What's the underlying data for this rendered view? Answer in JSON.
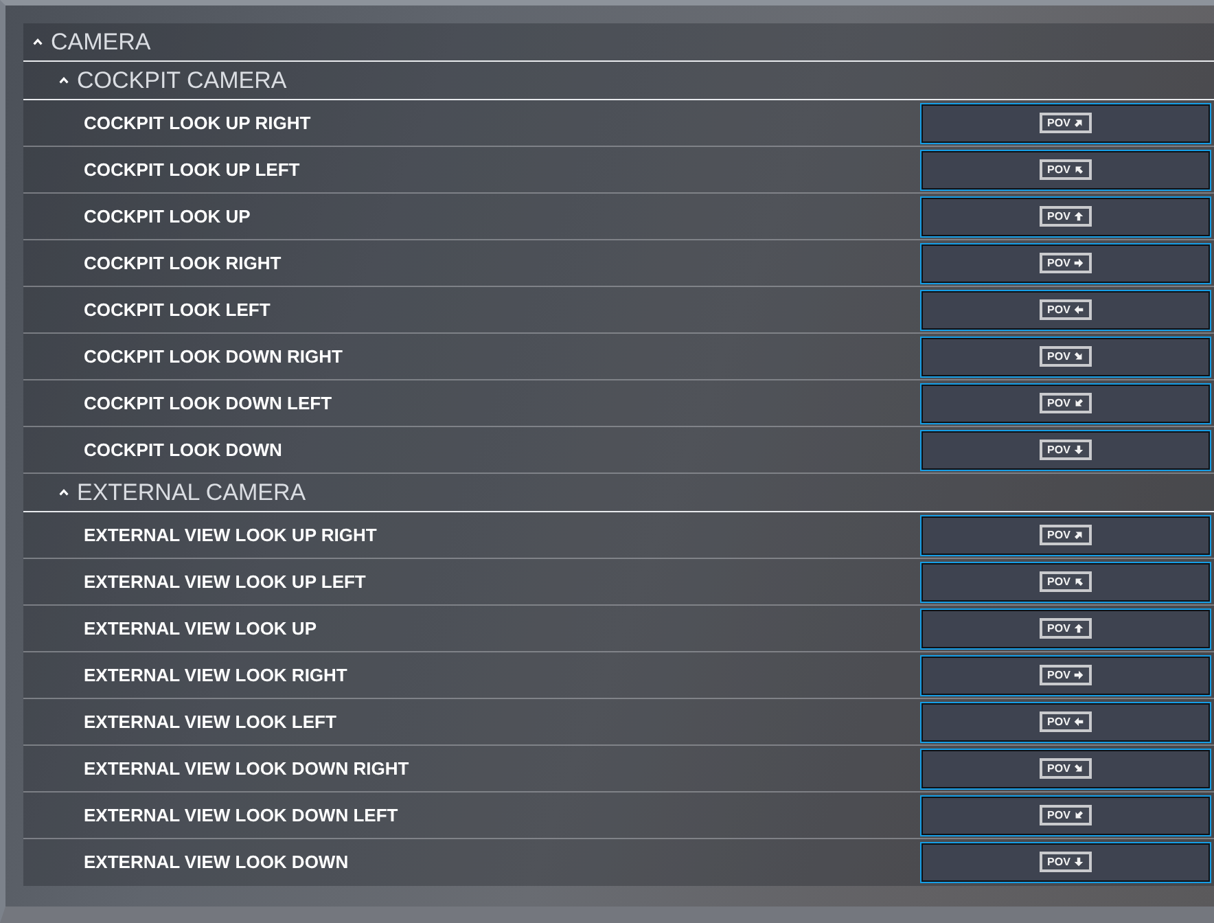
{
  "sections": [
    {
      "title": "CAMERA",
      "expanded": true,
      "groups": [
        {
          "title": "COCKPIT CAMERA",
          "expanded": true,
          "bindings": [
            {
              "action": "COCKPIT LOOK UP RIGHT",
              "key": {
                "label": "POV",
                "kind": "up-right"
              }
            },
            {
              "action": "COCKPIT LOOK UP LEFT",
              "key": {
                "label": "POV",
                "kind": "up-left"
              }
            },
            {
              "action": "COCKPIT LOOK UP",
              "key": {
                "label": "POV",
                "kind": "up"
              }
            },
            {
              "action": "COCKPIT LOOK RIGHT",
              "key": {
                "label": "POV",
                "kind": "right"
              }
            },
            {
              "action": "COCKPIT LOOK LEFT",
              "key": {
                "label": "POV",
                "kind": "left"
              }
            },
            {
              "action": "COCKPIT LOOK DOWN RIGHT",
              "key": {
                "label": "POV",
                "kind": "down-right"
              }
            },
            {
              "action": "COCKPIT LOOK DOWN LEFT",
              "key": {
                "label": "POV",
                "kind": "down-left"
              }
            },
            {
              "action": "COCKPIT LOOK DOWN",
              "key": {
                "label": "POV",
                "kind": "down"
              }
            }
          ]
        },
        {
          "title": "EXTERNAL CAMERA",
          "expanded": true,
          "bindings": [
            {
              "action": "EXTERNAL VIEW LOOK UP RIGHT",
              "key": {
                "label": "POV",
                "kind": "up-right"
              }
            },
            {
              "action": "EXTERNAL VIEW LOOK UP LEFT",
              "key": {
                "label": "POV",
                "kind": "up-left"
              }
            },
            {
              "action": "EXTERNAL VIEW LOOK UP",
              "key": {
                "label": "POV",
                "kind": "up"
              }
            },
            {
              "action": "EXTERNAL VIEW LOOK RIGHT",
              "key": {
                "label": "POV",
                "kind": "right"
              }
            },
            {
              "action": "EXTERNAL VIEW LOOK LEFT",
              "key": {
                "label": "POV",
                "kind": "left"
              }
            },
            {
              "action": "EXTERNAL VIEW LOOK DOWN RIGHT",
              "key": {
                "label": "POV",
                "kind": "down-right"
              }
            },
            {
              "action": "EXTERNAL VIEW LOOK DOWN LEFT",
              "key": {
                "label": "POV",
                "kind": "down-left"
              }
            },
            {
              "action": "EXTERNAL VIEW LOOK DOWN",
              "key": {
                "label": "POV",
                "kind": "down"
              }
            }
          ]
        }
      ]
    }
  ]
}
